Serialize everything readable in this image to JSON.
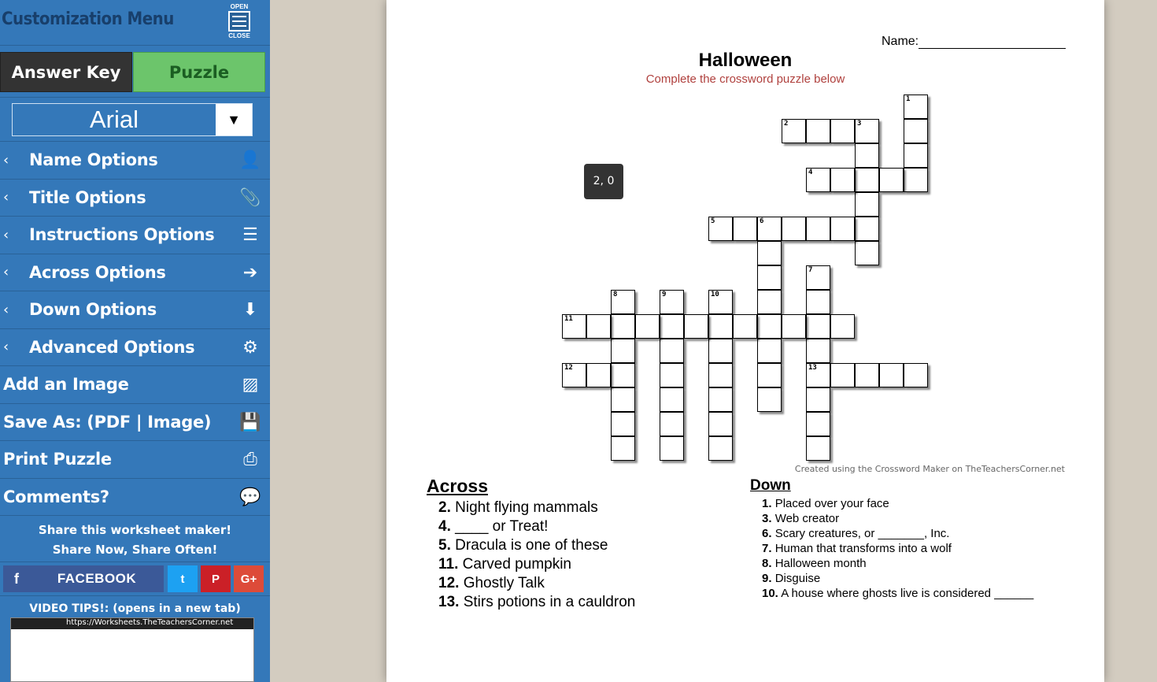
{
  "sidebar": {
    "title": "Customization Menu",
    "toggle_open": "OPEN",
    "toggle_close": "CLOSE",
    "answer_key_label": "Answer Key",
    "puzzle_label": "Puzzle",
    "font_value": "Arial",
    "items": [
      {
        "label": "Name Options",
        "icon": "user-icon",
        "glyph": "👤"
      },
      {
        "label": "Title Options",
        "icon": "paperclip-icon",
        "glyph": "📎"
      },
      {
        "label": "Instructions Options",
        "icon": "list-icon",
        "glyph": "☰"
      },
      {
        "label": "Across Options",
        "icon": "arrow-right-circle-icon",
        "glyph": "➔"
      },
      {
        "label": "Down Options",
        "icon": "arrow-down-circle-icon",
        "glyph": "⬇"
      },
      {
        "label": "Advanced Options",
        "icon": "gears-icon",
        "glyph": "⚙"
      },
      {
        "label": "Add an Image",
        "icon": "image-icon",
        "glyph": "▨"
      },
      {
        "label": "Save As: (PDF | Image)",
        "icon": "floppy-icon",
        "glyph": "💾"
      },
      {
        "label": "Print Puzzle",
        "icon": "print-icon",
        "glyph": "⎙"
      },
      {
        "label": "Comments?",
        "icon": "comments-icon",
        "glyph": "💬"
      }
    ],
    "share_line1": "Share this worksheet maker!",
    "share_line2": "Share Now, Share Often!",
    "facebook_label": "FACEBOOK",
    "video_tips": "VIDEO TIPS!: (opens in a new tab)",
    "video_url": "https://Worksheets.TheTeachersCorner.net"
  },
  "worksheet": {
    "name_label": "Name:",
    "title": "Halloween",
    "subtitle": "Complete the crossword puzzle below",
    "credit": "Created using the Crossword Maker on TheTeachersCorner.net",
    "tooltip": "2, 0",
    "across_heading": "Across",
    "down_heading": "Down",
    "across": [
      {
        "num": "2.",
        "text": "Night flying mammals"
      },
      {
        "num": "4.",
        "text": "____ or Treat!"
      },
      {
        "num": "5.",
        "text": "Dracula is one of these"
      },
      {
        "num": "11.",
        "text": "Carved pumpkin"
      },
      {
        "num": "12.",
        "text": "Ghostly Talk"
      },
      {
        "num": "13.",
        "text": "Stirs potions in a cauldron"
      }
    ],
    "down": [
      {
        "num": "1.",
        "text": "Placed over your face"
      },
      {
        "num": "3.",
        "text": "Web creator"
      },
      {
        "num": "6.",
        "text": "Scary creatures, or _______, Inc."
      },
      {
        "num": "7.",
        "text": "Human that transforms into a wolf"
      },
      {
        "num": "8.",
        "text": "Halloween month"
      },
      {
        "num": "9.",
        "text": "Disguise"
      },
      {
        "num": "10.",
        "text": "A house where ghosts live is considered ______"
      }
    ]
  },
  "crossword": {
    "words": [
      {
        "num": "1",
        "dir": "down",
        "row": 0,
        "col": 14,
        "len": 4
      },
      {
        "num": "2",
        "dir": "across",
        "row": 1,
        "col": 9,
        "len": 4
      },
      {
        "num": "3",
        "dir": "down",
        "row": 1,
        "col": 12,
        "len": 6
      },
      {
        "num": "4",
        "dir": "across",
        "row": 3,
        "col": 10,
        "len": 5
      },
      {
        "num": "5",
        "dir": "across",
        "row": 5,
        "col": 6,
        "len": 7
      },
      {
        "num": "6",
        "dir": "down",
        "row": 5,
        "col": 8,
        "len": 8
      },
      {
        "num": "7",
        "dir": "down",
        "row": 7,
        "col": 10,
        "len": 8
      },
      {
        "num": "8",
        "dir": "down",
        "row": 8,
        "col": 2,
        "len": 7
      },
      {
        "num": "9",
        "dir": "down",
        "row": 8,
        "col": 4,
        "len": 7
      },
      {
        "num": "10",
        "dir": "down",
        "row": 8,
        "col": 6,
        "len": 7
      },
      {
        "num": "11",
        "dir": "across",
        "row": 9,
        "col": 0,
        "len": 12
      },
      {
        "num": "12",
        "dir": "across",
        "row": 11,
        "col": 0,
        "len": 3
      },
      {
        "num": "13",
        "dir": "across",
        "row": 11,
        "col": 10,
        "len": 5
      }
    ]
  }
}
